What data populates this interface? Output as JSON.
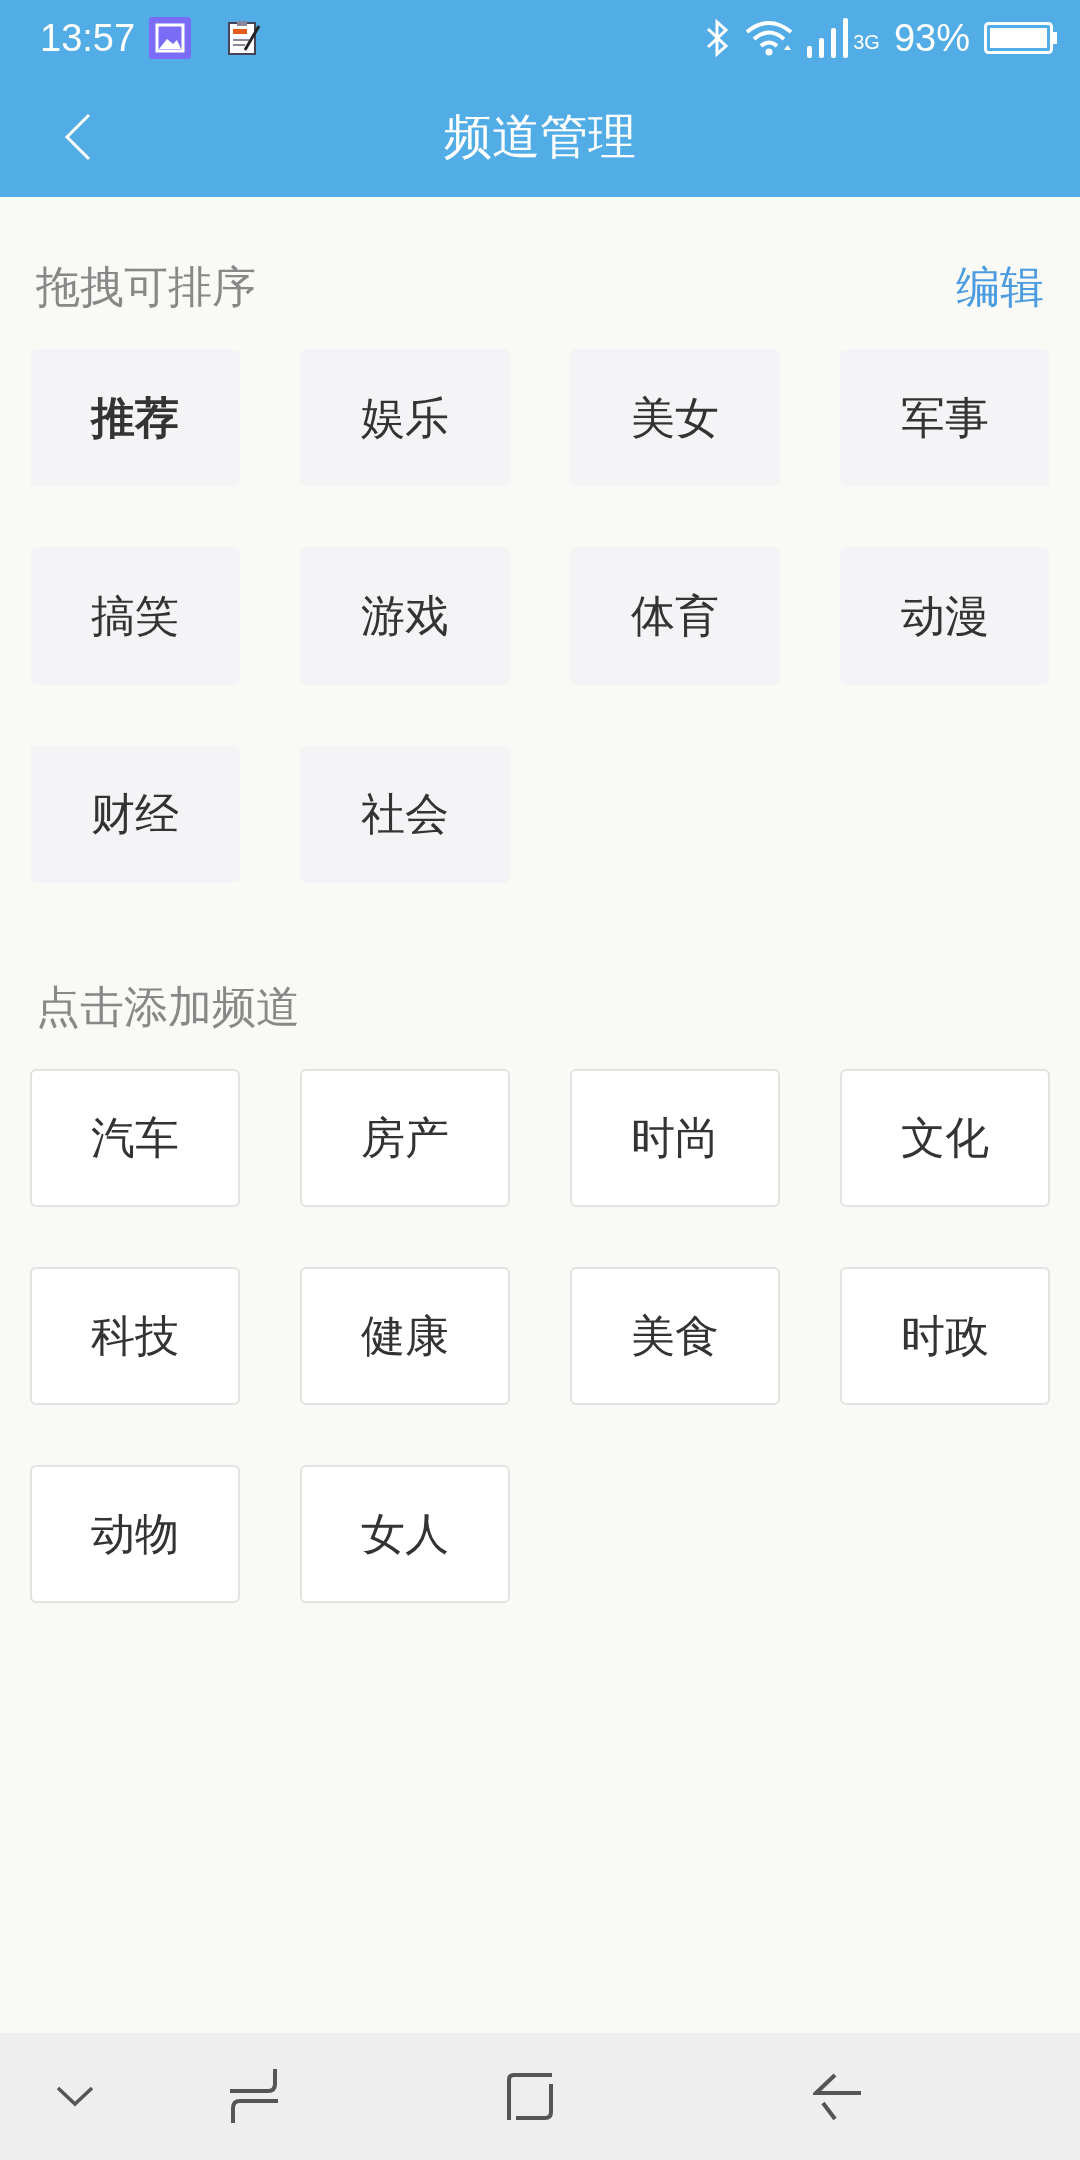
{
  "status_bar": {
    "time": "13:57",
    "network": "3G",
    "battery": "93%"
  },
  "header": {
    "title": "频道管理"
  },
  "sections": [
    {
      "kind": "sortable",
      "title": "拖拽可排序",
      "action": "编辑",
      "channels": [
        {
          "label": "推荐",
          "selected": true
        },
        {
          "label": "娱乐",
          "selected": false
        },
        {
          "label": "美女",
          "selected": false
        },
        {
          "label": "军事",
          "selected": false
        },
        {
          "label": "搞笑",
          "selected": false
        },
        {
          "label": "游戏",
          "selected": false
        },
        {
          "label": "体育",
          "selected": false
        },
        {
          "label": "动漫",
          "selected": false
        },
        {
          "label": "财经",
          "selected": false
        },
        {
          "label": "社会",
          "selected": false
        }
      ]
    },
    {
      "kind": "addable",
      "title": "点击添加频道",
      "channels": [
        {
          "label": "汽车",
          "selected": false
        },
        {
          "label": "房产",
          "selected": false
        },
        {
          "label": "时尚",
          "selected": false
        },
        {
          "label": "文化",
          "selected": false
        },
        {
          "label": "科技",
          "selected": false
        },
        {
          "label": "健康",
          "selected": false
        },
        {
          "label": "美食",
          "selected": false
        },
        {
          "label": "时政",
          "selected": false
        },
        {
          "label": "动物",
          "selected": false
        },
        {
          "label": "女人",
          "selected": false
        }
      ]
    }
  ]
}
